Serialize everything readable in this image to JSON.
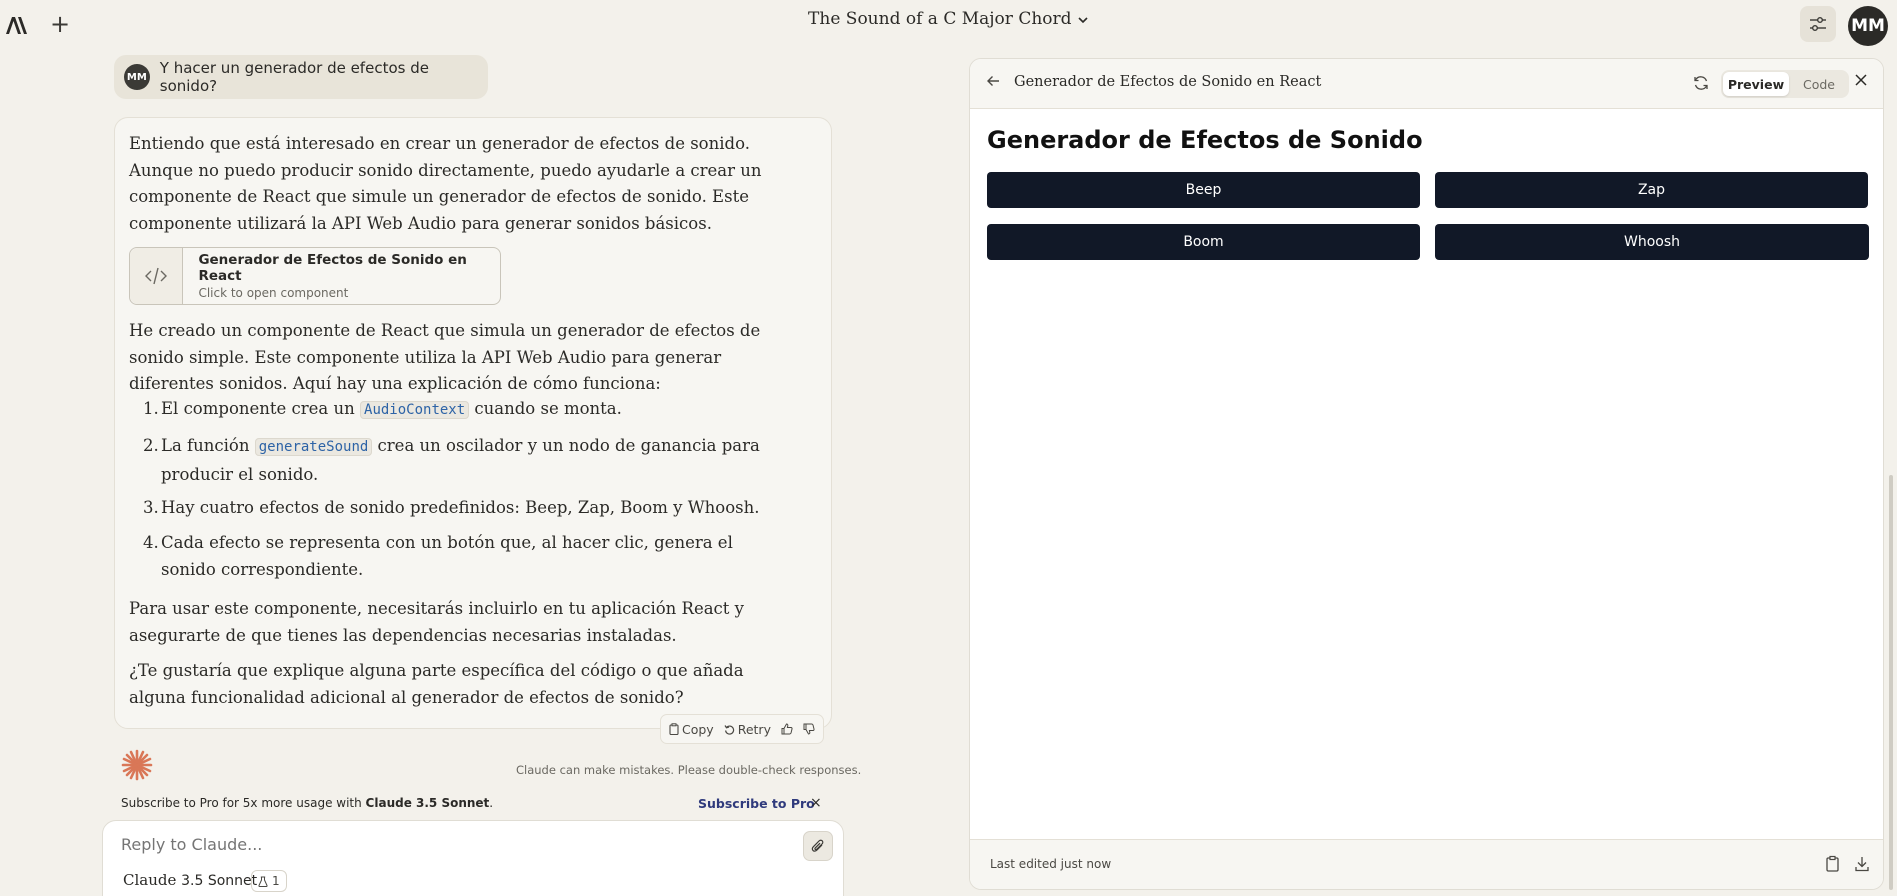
{
  "header": {
    "chat_title": "The Sound of a C Major Chord",
    "user_initials": "MM"
  },
  "user_message": {
    "initials": "MM",
    "text": "Y hacer un generador de efectos de sonido?"
  },
  "assistant": {
    "intro": "Entiendo que está interesado en crear un generador de efectos de sonido. Aunque no puedo producir sonido directamente, puedo ayudarle a crear un componente de React que simule un generador de efectos de sonido. Este componente utilizará la API Web Audio para generar sonidos básicos.",
    "artifact_card": {
      "name": "Generador de Efectos de Sonido en React",
      "subtitle": "Click to open component"
    },
    "explanation": "He creado un componente de React que simula un generador de efectos de sonido simple. Este componente utiliza la API Web Audio para generar diferentes sonidos. Aquí hay una explicación de cómo funciona:",
    "steps": [
      {
        "num": "1.",
        "before": "El componente crea un ",
        "code": "AudioContext",
        "after": " cuando se monta."
      },
      {
        "num": "2.",
        "before": "La función ",
        "code": "generateSound",
        "after": " crea un oscilador y un nodo de ganancia para producir el sonido."
      },
      {
        "num": "3.",
        "before": "Hay cuatro efectos de sonido predefinidos: Beep, Zap, Boom y Whoosh.",
        "code": "",
        "after": ""
      },
      {
        "num": "4.",
        "before": "Cada efecto se representa con un botón que, al hacer clic, genera el sonido correspondiente.",
        "code": "",
        "after": ""
      }
    ],
    "usage": "Para usar este componente, necesitarás incluirlo en tu aplicación React y asegurarte de que tienes las dependencias necesarias instaladas.",
    "question": "¿Te gustaría que explique alguna parte específica del código o que añada alguna funcionalidad adicional al generador de efectos de sonido?",
    "actions": {
      "copy": "Copy",
      "retry": "Retry"
    }
  },
  "disclaimer": "Claude can make mistakes. Please double-check responses.",
  "subscribe": {
    "text_prefix": "Subscribe to Pro for 5x more usage with ",
    "text_model": "Claude 3.5 Sonnet",
    "text_suffix": ".",
    "link": "Subscribe to Pro",
    "close": "×"
  },
  "composer": {
    "placeholder": "Reply to Claude...",
    "model_brand": "Claude",
    "model_version": "3.5 Sonnet",
    "badge_count": "1"
  },
  "panel": {
    "title": "Generador de Efectos de Sonido en React",
    "toggle_preview": "Preview",
    "toggle_code": "Code",
    "preview": {
      "heading": "Generador de Efectos de Sonido",
      "buttons": [
        "Beep",
        "Zap",
        "Boom",
        "Whoosh"
      ]
    },
    "footer": "Last edited just now"
  },
  "colors": {
    "background": "#f3f1eb",
    "button_dark": "#111827",
    "accent_orange": "#d97757",
    "link_blue": "#2f3a7c"
  }
}
